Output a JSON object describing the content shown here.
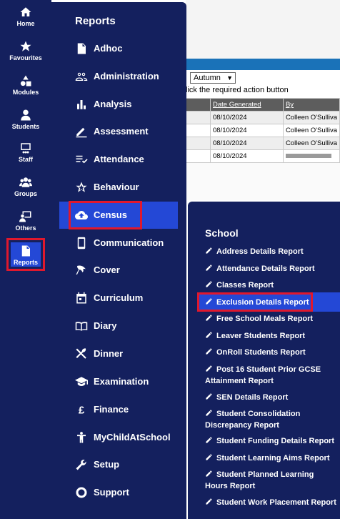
{
  "rail": {
    "items": [
      {
        "label": "Home",
        "icon": "home-icon"
      },
      {
        "label": "Favourites",
        "icon": "star-icon"
      },
      {
        "label": "Modules",
        "icon": "modules-icon"
      },
      {
        "label": "Students",
        "icon": "person-icon"
      },
      {
        "label": "Staff",
        "icon": "staff-icon"
      },
      {
        "label": "Groups",
        "icon": "groups-icon"
      },
      {
        "label": "Others",
        "icon": "others-icon"
      },
      {
        "label": "Reports",
        "icon": "report-icon"
      }
    ],
    "active": "Reports"
  },
  "menu": {
    "title": "Reports",
    "items": [
      {
        "label": "Adhoc",
        "icon": "document-icon"
      },
      {
        "label": "Administration",
        "icon": "people-icon"
      },
      {
        "label": "Analysis",
        "icon": "bar-chart-icon"
      },
      {
        "label": "Assessment",
        "icon": "pencil-icon"
      },
      {
        "label": "Attendance",
        "icon": "checklist-icon"
      },
      {
        "label": "Behaviour",
        "icon": "star-outline-icon"
      },
      {
        "label": "Census",
        "icon": "cloud-upload-icon"
      },
      {
        "label": "Communication",
        "icon": "phone-icon"
      },
      {
        "label": "Cover",
        "icon": "cover-icon"
      },
      {
        "label": "Curriculum",
        "icon": "calendar-icon"
      },
      {
        "label": "Diary",
        "icon": "book-icon"
      },
      {
        "label": "Dinner",
        "icon": "cutlery-icon"
      },
      {
        "label": "Examination",
        "icon": "graduation-cap-icon"
      },
      {
        "label": "Finance",
        "icon": "pound-icon"
      },
      {
        "label": "MyChildAtSchool",
        "icon": "child-icon"
      },
      {
        "label": "Setup",
        "icon": "wrench-icon"
      },
      {
        "label": "Support",
        "icon": "lifebuoy-icon"
      }
    ],
    "active": "Census"
  },
  "school": {
    "title": "School",
    "items": [
      {
        "label": "Address Details Report"
      },
      {
        "label": "Attendance Details Report"
      },
      {
        "label": "Classes Report"
      },
      {
        "label": "Exclusion Details Report"
      },
      {
        "label": "Free School Meals Report"
      },
      {
        "label": "Leaver Students Report"
      },
      {
        "label": "OnRoll Students Report"
      },
      {
        "label": "Post 16 Student Prior GCSE Attainment Report"
      },
      {
        "label": "SEN Details Report"
      },
      {
        "label": "Student Consolidation Discrepancy Report"
      },
      {
        "label": "Student Funding Details Report"
      },
      {
        "label": "Student Learning Aims Report"
      },
      {
        "label": "Student Planned Learning Hours Report"
      },
      {
        "label": "Student Work Placement Report"
      }
    ],
    "active": "Exclusion Details Report"
  },
  "background": {
    "term_select": "Autumn",
    "instruction": "lick the required action button",
    "columns": [
      "",
      "Date Generated",
      "By"
    ],
    "rows": [
      [
        "",
        "08/10/2024",
        "Colleen O'Sulliva"
      ],
      [
        "",
        "08/10/2024",
        "Colleen O'Sulliva"
      ],
      [
        "",
        "08/10/2024",
        "Colleen O'Sulliva"
      ],
      [
        "",
        "08/10/2024",
        ""
      ]
    ]
  },
  "colors": {
    "nav": "#14205e",
    "active": "#2448d6",
    "highlight_border": "#e0182d",
    "table_header": "#5d5d5d"
  }
}
